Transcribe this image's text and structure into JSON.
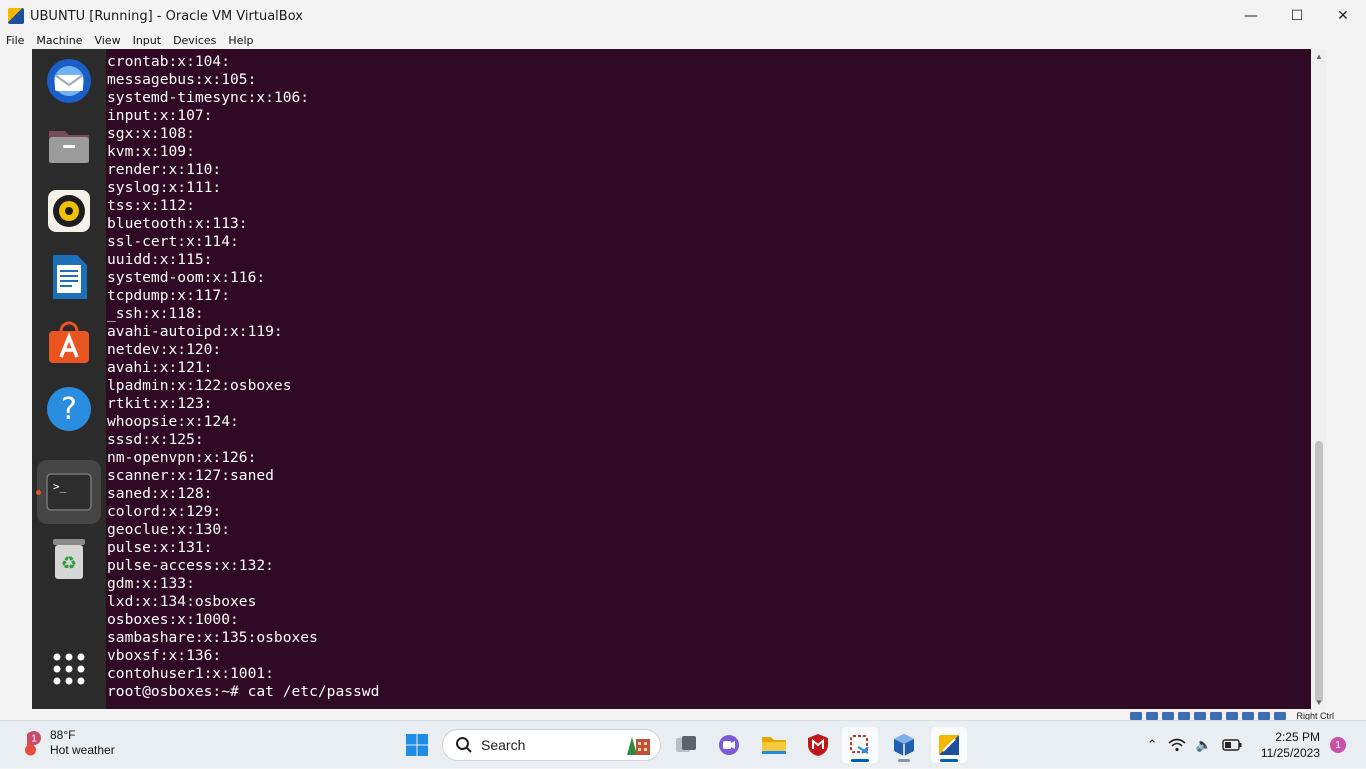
{
  "window": {
    "title": "UBUNTU [Running] - Oracle VM VirtualBox",
    "minimize_icon": "—",
    "maximize_icon": "☐",
    "close_icon": "✕"
  },
  "menu": [
    "File",
    "Machine",
    "View",
    "Input",
    "Devices",
    "Help"
  ],
  "dock": [
    {
      "name": "thunderbird-icon",
      "active": false
    },
    {
      "name": "files-icon",
      "active": false
    },
    {
      "name": "rhythmbox-icon",
      "active": false
    },
    {
      "name": "libreoffice-writer-icon",
      "active": false
    },
    {
      "name": "software-center-icon",
      "active": false
    },
    {
      "name": "help-icon",
      "active": false
    },
    {
      "name": "terminal-icon",
      "active": true
    },
    {
      "name": "trash-icon",
      "active": false
    }
  ],
  "terminal": {
    "lines": [
      "crontab:x:104:",
      "messagebus:x:105:",
      "systemd-timesync:x:106:",
      "input:x:107:",
      "sgx:x:108:",
      "kvm:x:109:",
      "render:x:110:",
      "syslog:x:111:",
      "tss:x:112:",
      "bluetooth:x:113:",
      "ssl-cert:x:114:",
      "uuidd:x:115:",
      "systemd-oom:x:116:",
      "tcpdump:x:117:",
      "_ssh:x:118:",
      "avahi-autoipd:x:119:",
      "netdev:x:120:",
      "avahi:x:121:",
      "lpadmin:x:122:osboxes",
      "rtkit:x:123:",
      "whoopsie:x:124:",
      "sssd:x:125:",
      "nm-openvpn:x:126:",
      "scanner:x:127:saned",
      "saned:x:128:",
      "colord:x:129:",
      "geoclue:x:130:",
      "pulse:x:131:",
      "pulse-access:x:132:",
      "gdm:x:133:",
      "lxd:x:134:osboxes",
      "osboxes:x:1000:",
      "sambashare:x:135:osboxes",
      "vboxsf:x:136:",
      "contohuser1:x:1001:",
      "root@osboxes:~# cat /etc/passwd"
    ]
  },
  "vbox_status": {
    "host_key": "Right Ctrl"
  },
  "taskbar": {
    "weather_temp": "88°F",
    "weather_desc": "Hot weather",
    "weather_badge": "1",
    "search_label": "Search",
    "apps": [
      {
        "name": "start-button",
        "active": false
      },
      {
        "name": "task-view-icon",
        "active": false
      },
      {
        "name": "teams-chat-icon",
        "active": false
      },
      {
        "name": "file-explorer-icon",
        "active": false
      },
      {
        "name": "mcafee-icon",
        "active": false
      },
      {
        "name": "snipping-tool-icon",
        "active": true
      },
      {
        "name": "virtualbox-manager-icon",
        "active": false
      },
      {
        "name": "virtualbox-vm-icon",
        "active": true
      }
    ],
    "clock_time": "2:25 PM",
    "clock_date": "11/25/2023",
    "notification_count": "1"
  }
}
